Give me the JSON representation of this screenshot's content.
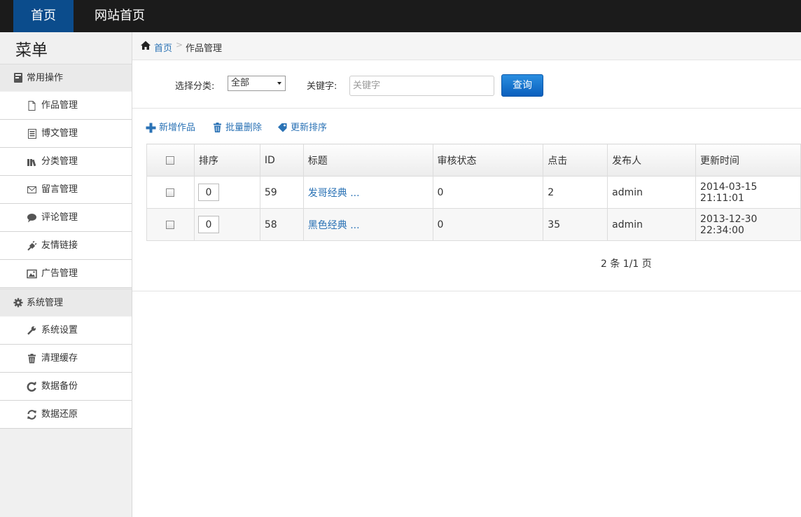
{
  "topnav": {
    "items": [
      {
        "label": "首页",
        "active": true
      },
      {
        "label": "网站首页",
        "active": false
      }
    ],
    "active_bg": "#0b4c8c"
  },
  "sidebar": {
    "title": "菜单",
    "groups": [
      {
        "label": "常用操作",
        "icon": "book-icon",
        "items": [
          {
            "label": "作品管理",
            "icon": "file-icon"
          },
          {
            "label": "博文管理",
            "icon": "document-icon"
          },
          {
            "label": "分类管理",
            "icon": "books-icon"
          },
          {
            "label": "留言管理",
            "icon": "envelope-icon"
          },
          {
            "label": "评论管理",
            "icon": "comment-icon"
          },
          {
            "label": "友情链接",
            "icon": "plug-icon"
          },
          {
            "label": "广告管理",
            "icon": "picture-icon"
          }
        ]
      },
      {
        "label": "系统管理",
        "icon": "gear-icon",
        "items": [
          {
            "label": "系统设置",
            "icon": "wrench-icon"
          },
          {
            "label": "清理缓存",
            "icon": "trash-icon"
          },
          {
            "label": "数据备份",
            "icon": "backup-icon"
          },
          {
            "label": "数据还原",
            "icon": "refresh-icon"
          }
        ]
      }
    ]
  },
  "breadcrumb": {
    "home": "首页",
    "separator": ">",
    "current": "作品管理"
  },
  "filter": {
    "category_label": "选择分类:",
    "category_value": "全部",
    "keyword_label": "关键字:",
    "keyword_placeholder": "关键字",
    "keyword_value": "",
    "search_button": "查询"
  },
  "actions": {
    "add": "新增作品",
    "batch_delete": "批量删除",
    "update_sort": "更新排序"
  },
  "table": {
    "headers": [
      "排序",
      "ID",
      "标题",
      "审核状态",
      "点击",
      "发布人",
      "更新时间"
    ],
    "rows": [
      {
        "sort": "0",
        "id": "59",
        "title": "发哥经典 ...",
        "status": "0",
        "clicks": "2",
        "author": "admin",
        "updated": "2014-03-15 21:11:01"
      },
      {
        "sort": "0",
        "id": "58",
        "title": "黑色经典 ...",
        "status": "0",
        "clicks": "35",
        "author": "admin",
        "updated": "2013-12-30 22:34:00"
      }
    ]
  },
  "pager": {
    "text": "2 条 1/1 页"
  },
  "colors": {
    "link": "#2a72b5",
    "topbar_bg": "#1b1b1b",
    "search_button": "#0a5fbd"
  }
}
